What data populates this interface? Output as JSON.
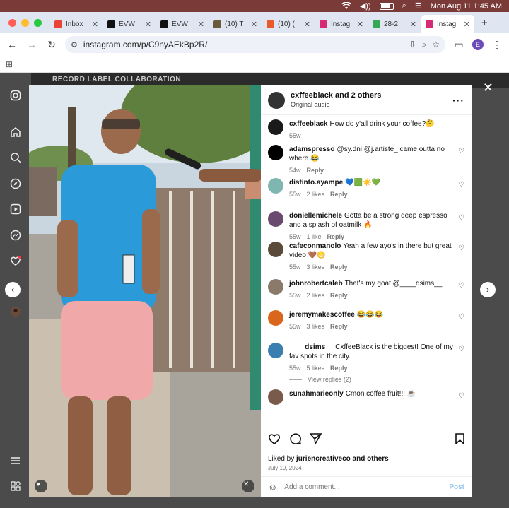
{
  "menubar": {
    "datetime": "Mon Aug 11  1:45 AM"
  },
  "tabs": [
    {
      "title": "Inbox",
      "color": "#ea4335",
      "active": false
    },
    {
      "title": "EVW",
      "color": "#111111",
      "active": false
    },
    {
      "title": "EVW",
      "color": "#111111",
      "active": false
    },
    {
      "title": "(10) T",
      "color": "#6b5b3a",
      "active": false
    },
    {
      "title": "(10) (",
      "color": "#e85a2b",
      "active": false
    },
    {
      "title": "Instag",
      "color": "#d62976",
      "active": false
    },
    {
      "title": "28-2",
      "color": "#34a853",
      "active": false
    },
    {
      "title": "Instag",
      "color": "#d62976",
      "active": true
    }
  ],
  "toolbar": {
    "url": "instagram.com/p/C9nyAEkBp2R/",
    "profile_initial": "E"
  },
  "background": {
    "strip_label": "RECORD LABEL COLLABORATION"
  },
  "post": {
    "header": {
      "user": "cxffeeblack",
      "and_others": "and 2 others",
      "audio": "Original audio"
    },
    "comments": [
      {
        "user": "cxffeeblack",
        "text": "How do y'all drink your coffee?🤔",
        "time": "55w",
        "likes": "",
        "reply": "",
        "avatar_color": "#1a1a1a"
      },
      {
        "user": "adamspresso",
        "text": "@sy.dni @j.artiste_ came outta no where 😂",
        "time": "54w",
        "likes": "",
        "reply": "Reply",
        "avatar_color": "#000000"
      },
      {
        "user": "distinto.ayampe",
        "text": "💙🟩☀️💚",
        "time": "55w",
        "likes": "2 likes",
        "reply": "Reply",
        "avatar_color": "#7fb7b0"
      },
      {
        "user": "doniellemichele",
        "text": "Gotta be a strong deep espresso and a splash of oatmilk 🔥",
        "time": "55w",
        "likes": "1 like",
        "reply": "Reply",
        "avatar_color": "#6a4a6e"
      },
      {
        "user": "cafeconmanolo",
        "text": "Yeah a few ayo's in there but great video 🤎😁",
        "time": "55w",
        "likes": "3 likes",
        "reply": "Reply",
        "avatar_color": "#5b4a3a"
      },
      {
        "user": "johnrobertcaleb",
        "text": "That's my goat @____dsims__",
        "time": "55w",
        "likes": "2 likes",
        "reply": "Reply",
        "avatar_color": "#8a7a6a"
      },
      {
        "user": "jeremymakescoffee",
        "text": "😂😂😂",
        "time": "55w",
        "likes": "3 likes",
        "reply": "Reply",
        "avatar_color": "#d9661c"
      },
      {
        "user": "____dsims__",
        "text": "CxffeeBlack is the biggest! One of my fav spots in the city.",
        "time": "55w",
        "likes": "5 likes",
        "reply": "Reply",
        "avatar_color": "#3a7fb0"
      },
      {
        "user": "sunahmarieonly",
        "text": "Cmon coffee fruit!!! ☕",
        "time": "",
        "likes": "",
        "reply": "",
        "avatar_color": "#7a5a4a"
      }
    ],
    "view_replies": "View replies (2)",
    "liked_by": "Liked by",
    "liked_user": "juriencreativeco",
    "and_others": "and others",
    "date": "July 19, 2024",
    "add_comment_placeholder": "Add a comment...",
    "post_label": "Post"
  },
  "icons": {
    "sidenav": [
      "instagram-logo-icon",
      "home-icon",
      "search-icon",
      "explore-icon",
      "reels-icon",
      "messenger-icon",
      "notifications-icon",
      "profile-icon",
      "menu-icon",
      "more-icon"
    ]
  }
}
